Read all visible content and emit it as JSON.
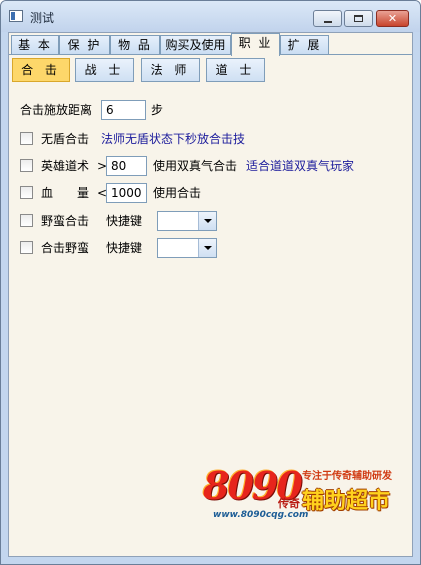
{
  "window": {
    "title": "测试",
    "close_glyph": "✕"
  },
  "tabs": [
    {
      "label": "基 本"
    },
    {
      "label": "保 护"
    },
    {
      "label": "物 品"
    },
    {
      "label": "购买及使用"
    },
    {
      "label": "职 业"
    },
    {
      "label": "扩 展"
    }
  ],
  "active_tab": "职 业",
  "subtabs": [
    {
      "label": "合 击"
    },
    {
      "label": "战 士"
    },
    {
      "label": "法 师"
    },
    {
      "label": "道 士"
    }
  ],
  "active_subtab": "合 击",
  "distance": {
    "label": "合击施放距离",
    "value": "6",
    "unit": "步"
  },
  "options": {
    "no_shield": {
      "label": "无盾合击",
      "note": "法师无盾状态下秒放合击技"
    },
    "hero_dao": {
      "label": "英雄道术",
      "op": ">",
      "value": "80",
      "after": "使用双真气合击",
      "note": "适合道道双真气玩家"
    },
    "blood": {
      "label": "血",
      "label2": "量",
      "op": "<",
      "value": "1000",
      "after": "使用合击"
    },
    "wild_combo": {
      "label": "野蛮合击",
      "hotkey_label": "快捷键",
      "hotkey_value": ""
    },
    "combo_wild": {
      "label": "合击野蛮",
      "hotkey_label": "快捷键",
      "hotkey_value": ""
    }
  },
  "logo": {
    "number": "8090",
    "chuanqi": "传奇",
    "tagline": "专注于传奇辅助研发",
    "main": "辅助超市",
    "site": "www.8090cqg.com"
  }
}
